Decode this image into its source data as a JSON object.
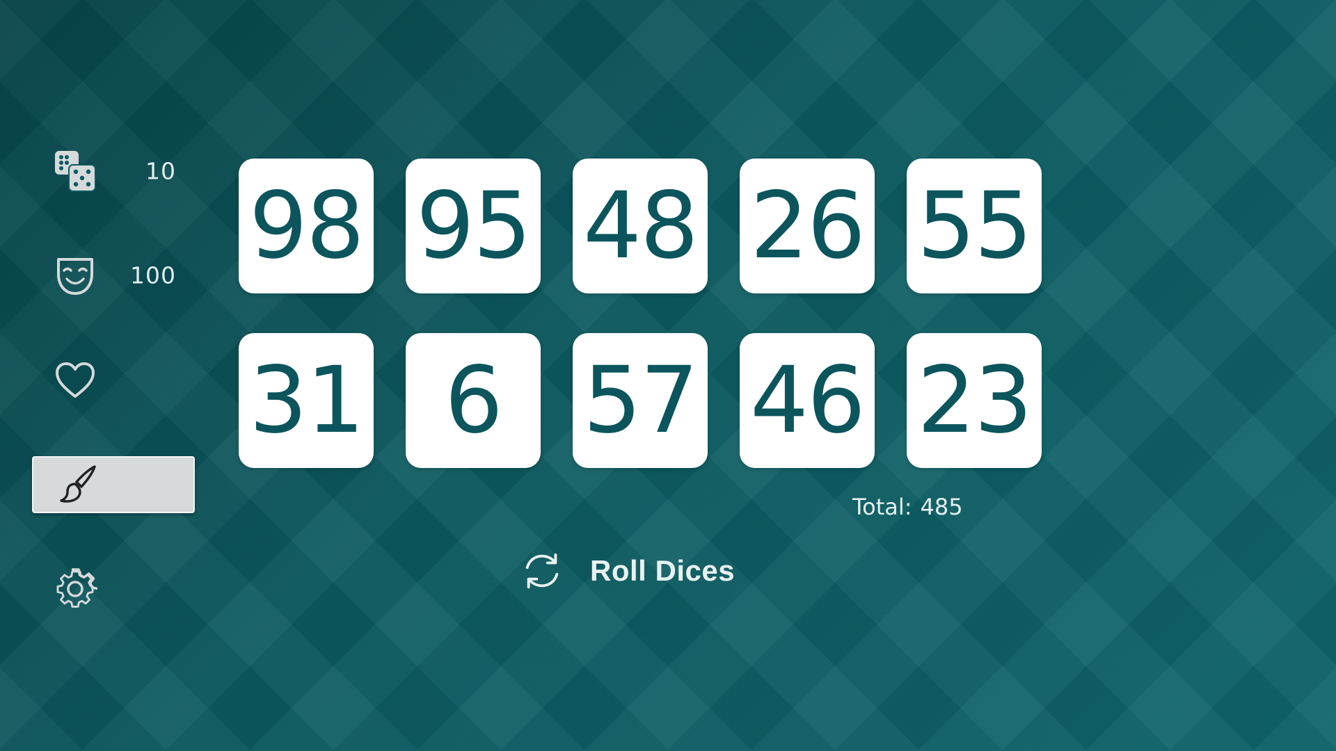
{
  "sidebar": {
    "items": [
      {
        "name": "dice-count",
        "icon": "dice-icon",
        "value": "10"
      },
      {
        "name": "max-value",
        "icon": "theater-mask-icon",
        "value": "100"
      },
      {
        "name": "favorites",
        "icon": "heart-icon",
        "value": ""
      },
      {
        "name": "theme",
        "icon": "paintbrush-icon",
        "value": "",
        "active": true
      },
      {
        "name": "settings",
        "icon": "gear-icon",
        "value": ""
      }
    ]
  },
  "dice": [
    "98",
    "95",
    "48",
    "26",
    "55",
    "31",
    "6",
    "57",
    "46",
    "23"
  ],
  "total": {
    "label": "Total:",
    "value": "485"
  },
  "roll_button": {
    "label": "Roll Dices",
    "icon": "refresh-icon"
  },
  "colors": {
    "background": "#0b5a60",
    "die_face": "#ffffff",
    "die_text": "#0c555d",
    "active_item": "#d7dadb"
  }
}
